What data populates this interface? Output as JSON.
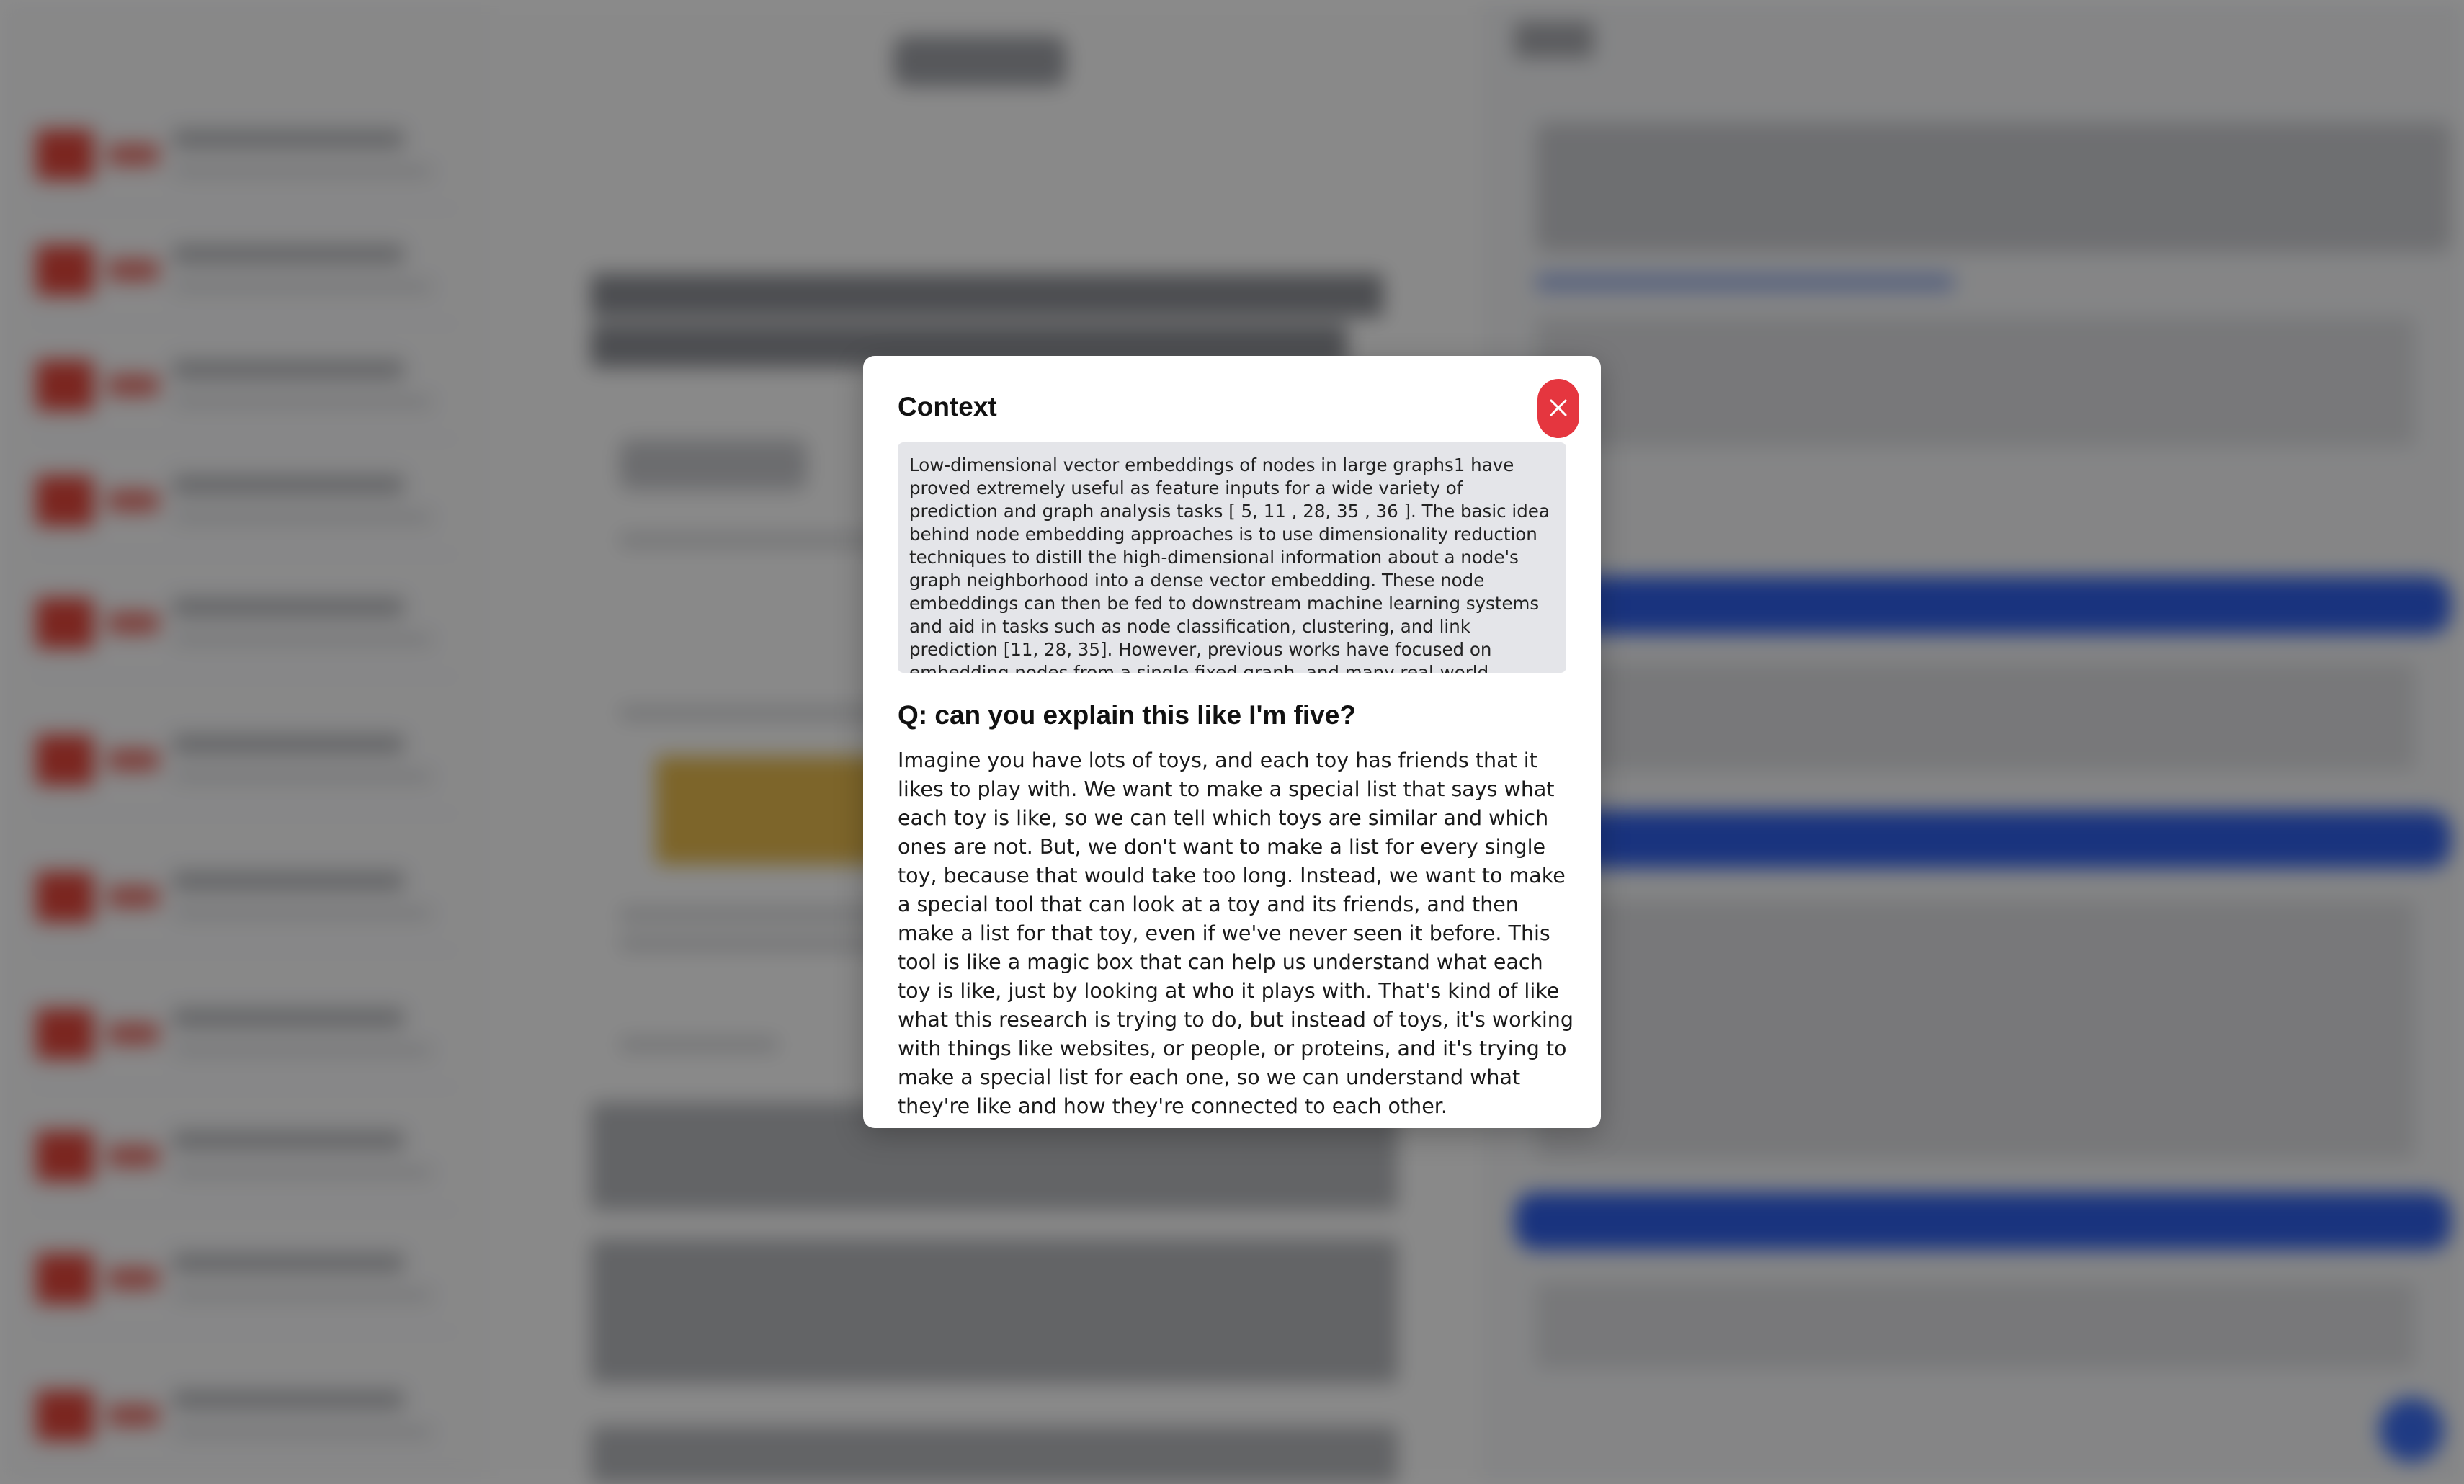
{
  "modal": {
    "title": "Context",
    "context_text": "Low-dimensional vector embeddings of nodes in large graphs1 have proved extremely useful as feature inputs for a wide variety of prediction and graph analysis tasks [ 5, 11 , 28, 35 , 36 ]. The basic idea behind node embedding approaches is to use dimensionality reduction techniques to distill the high-dimensional information about a node's graph neighborhood into a dense vector embedding. These node embeddings can then be fed to downstream machine learning systems and aid in tasks such as node classification, clustering, and link prediction [11, 28, 35]. However, previous works have focused on embedding nodes from a single fixed graph, and many real-world applications require embeddings to be quickly generated for unseen nodes, or",
    "question": "Q: can you explain this like I'm five?",
    "answer": "Imagine you have lots of toys, and each toy has friends that it likes to play with. We want to make a special list that says what each toy is like, so we can tell which toys are similar and which ones are not. But, we don't want to make a list for every single toy, because that would take too long. Instead, we want to make a special tool that can look at a toy and its friends, and then make a list for that toy, even if we've never seen it before. This tool is like a magic box that can help us understand what each toy is like, just by looking at who it plays with. That's kind of like what this research is trying to do, but instead of toys, it's working with things like websites, or people, or proteins, and it's trying to make a special list for each one, so we can understand what they're like and how they're connected to each other.",
    "close_icon": "close-icon"
  },
  "colors": {
    "close_button": "#e5363f",
    "context_background": "#e4e5e9",
    "overlay": "rgba(0,0,0,0.45)",
    "primary_blue": "#2f5ee6"
  }
}
